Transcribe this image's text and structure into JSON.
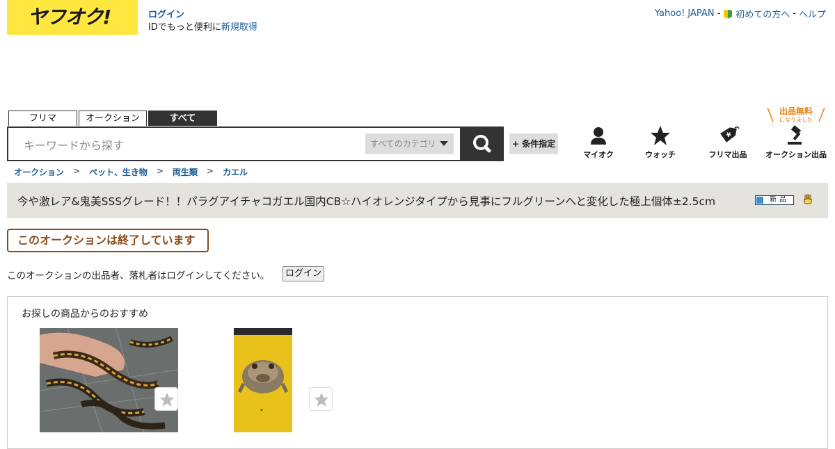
{
  "header": {
    "logo_text": "ヤフオク!",
    "login_label": "ログイン",
    "signup_prefix": "IDでもっと便利に",
    "signup_link": "新規取得",
    "links": [
      "Yahoo! JAPAN",
      "初めての方へ",
      "ヘルプ"
    ],
    "link_separator": "-"
  },
  "search": {
    "tabs": [
      "フリマ",
      "オークション",
      "すべて"
    ],
    "active_tab": "すべて",
    "placeholder": "キーワードから探す",
    "category": "すべてのカテゴリ",
    "condition_button": "+ 条件指定"
  },
  "nav": {
    "myauc": "マイオク",
    "watch": "ウォッチ",
    "flea_sell": "フリマ出品",
    "auction_sell": "オークション出品",
    "free_badge_main": "出品無料",
    "free_badge_sub": "になりました"
  },
  "breadcrumb": [
    "オークション",
    "ペット、生き物",
    "両生類",
    "カエル"
  ],
  "breadcrumb_separator": ">",
  "item": {
    "title": "今や激レア&鬼美SSSグレード！！パラグアイチャコガエル国内CB☆ハイオレンジタイプから見事にフルグリーンへと変化した極上個体±2.5cm",
    "new_badge": "新品"
  },
  "status": {
    "ended_label": "このオークションは終了しています",
    "notice": "このオークションの出品者、落札者はログインしてください。",
    "login_button": "ログイン"
  },
  "recommendations": {
    "title": "お探しの商品からのおすすめ",
    "items": [
      {
        "image": "salamanders-in-hand"
      },
      {
        "image": "horned-frog-on-yellow"
      }
    ]
  },
  "colors": {
    "brand_yellow": "#ffe73f",
    "dark": "#333333",
    "link_blue": "#1a5b9a",
    "ended_brown": "#8c4a17",
    "free_orange": "#e87f12"
  }
}
